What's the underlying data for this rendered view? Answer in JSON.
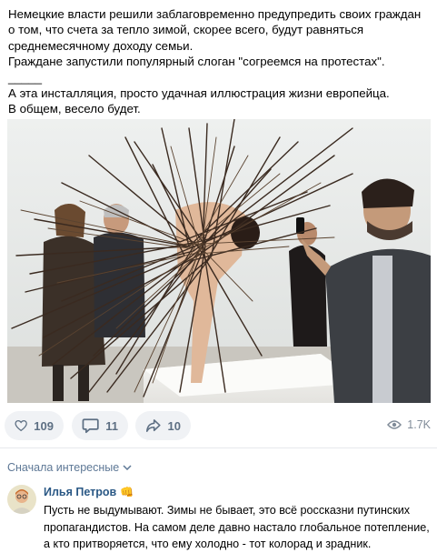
{
  "post": {
    "lines": [
      "Немецкие власти решили заблаговременно предупредить своих граждан о том, что счета за тепло зимой, скорее всего, будут равняться среднемесячному доходу семьи.",
      "Граждане запустили популярный слоган \"согреемся на протестах\".",
      "_____",
      "А эта инсталляция, просто удачная иллюстрация жизни европейца.",
      "В общем, весело будет."
    ]
  },
  "actions": {
    "likes": "109",
    "comments": "11",
    "reposts": "10",
    "views": "1.7K"
  },
  "comments_sort": {
    "label": "Сначала интересные"
  },
  "comment": {
    "author": "Илья Петров",
    "badge": "👊",
    "text": "Пусть не выдумывают. Зимы не бывает, это всё россказни путинских пропагандистов. На самом деле давно настало глобальное потепление, а кто притворяется, что ему холодно - тот колорад и зрадник."
  },
  "colors": {
    "accent": "#2a5885",
    "pill_bg": "#f0f2f5",
    "icon": "#5d6f83",
    "muted": "#818c99"
  }
}
